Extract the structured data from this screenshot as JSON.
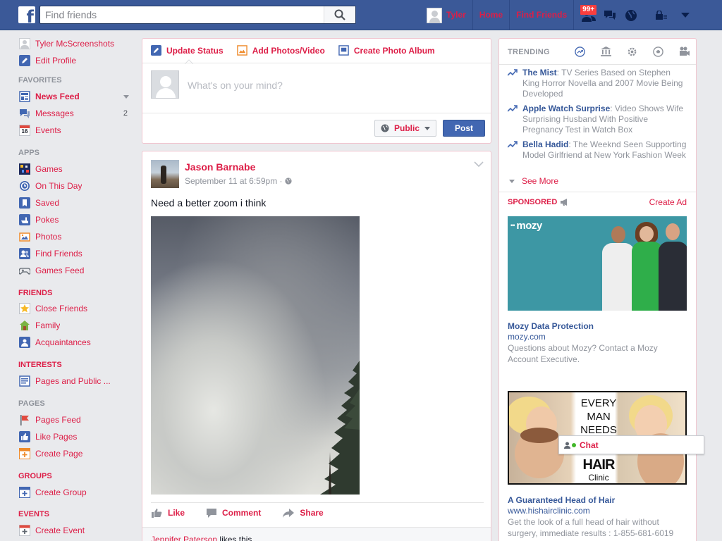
{
  "topbar": {
    "logo": "f",
    "search_placeholder": "Find friends",
    "user_name": "Tyler",
    "home": "Home",
    "find_friends": "Find Friends",
    "friend_requests_badge": "99+"
  },
  "left_nav": {
    "profile": {
      "name": "Tyler McScreenshots",
      "edit": "Edit Profile"
    },
    "favorites": {
      "title": "FAVORITES",
      "items": [
        {
          "label": "News Feed",
          "icon": "news-feed-icon"
        },
        {
          "label": "Messages",
          "icon": "messages-icon",
          "count": "2"
        },
        {
          "label": "Events",
          "icon": "calendar-icon",
          "date": "16"
        }
      ]
    },
    "apps": {
      "title": "APPS",
      "items": [
        {
          "label": "Games",
          "icon": "games-icon"
        },
        {
          "label": "On This Day",
          "icon": "on-this-day-icon"
        },
        {
          "label": "Saved",
          "icon": "saved-icon"
        },
        {
          "label": "Pokes",
          "icon": "pokes-icon"
        },
        {
          "label": "Photos",
          "icon": "photos-icon"
        },
        {
          "label": "Find Friends",
          "icon": "find-friends-icon"
        },
        {
          "label": "Games Feed",
          "icon": "games-feed-icon"
        }
      ]
    },
    "friends": {
      "title": "FRIENDS",
      "items": [
        {
          "label": "Close Friends",
          "icon": "star-icon"
        },
        {
          "label": "Family",
          "icon": "house-icon"
        },
        {
          "label": "Acquaintances",
          "icon": "acquaintances-icon"
        }
      ]
    },
    "interests": {
      "title": "INTERESTS",
      "items": [
        {
          "label": "Pages and Public ...",
          "icon": "interests-icon"
        }
      ]
    },
    "pages": {
      "title": "PAGES",
      "items": [
        {
          "label": "Pages Feed",
          "icon": "flag-icon"
        },
        {
          "label": "Like Pages",
          "icon": "like-icon"
        },
        {
          "label": "Create Page",
          "icon": "create-page-icon"
        }
      ]
    },
    "groups": {
      "title": "GROUPS",
      "items": [
        {
          "label": "Create Group",
          "icon": "create-group-icon"
        }
      ]
    },
    "events": {
      "title": "EVENTS",
      "items": [
        {
          "label": "Create Event",
          "icon": "create-event-icon"
        }
      ]
    }
  },
  "composer": {
    "tabs": [
      "Update Status",
      "Add Photos/Video",
      "Create Photo Album"
    ],
    "placeholder": "What's on your mind?",
    "privacy": "Public",
    "post": "Post"
  },
  "post": {
    "author": "Jason Barnabe",
    "timestamp": "September 11 at 6:59pm",
    "separator": "·",
    "text": "Need a better zoom i think",
    "actions": [
      "Like",
      "Comment",
      "Share"
    ],
    "liker": "Jennifer Paterson",
    "likes_suffix": " likes this."
  },
  "trending": {
    "title": "TRENDING",
    "items": [
      {
        "title": "The Mist",
        "desc": ": TV Series Based on Stephen King Horror Novella and 2007 Movie Being Developed"
      },
      {
        "title": "Apple Watch Surprise",
        "desc": ": Video Shows Wife Surprising Husband With Positive Pregnancy Test in Watch Box"
      },
      {
        "title": "Bella Hadid",
        "desc": ": The Weeknd Seen Supporting Model Girlfriend at New York Fashion Week"
      }
    ],
    "see_more": "See More"
  },
  "sponsored": {
    "title": "SPONSORED",
    "create_ad": "Create Ad",
    "ads": [
      {
        "logo": "mozy",
        "title": "Mozy Data Protection",
        "url": "mozy.com",
        "desc": "Questions about Mozy? Contact a Mozy Account Executive."
      },
      {
        "image_text": [
          "EVERY",
          "MAN",
          "NEEDS"
        ],
        "image_hair": "HAIR",
        "image_clinic": "Clinic",
        "title": "A Guaranteed Head of Hair",
        "url": "www.hishairclinic.com",
        "desc": "Get the look of a full head of hair without surgery, immediate results : 1-855-681-6019"
      }
    ]
  },
  "chat": {
    "label": "Chat"
  },
  "colors": {
    "brand_blue": "#3b5998",
    "link_red": "#dd1e47",
    "link_blue": "#365899"
  }
}
